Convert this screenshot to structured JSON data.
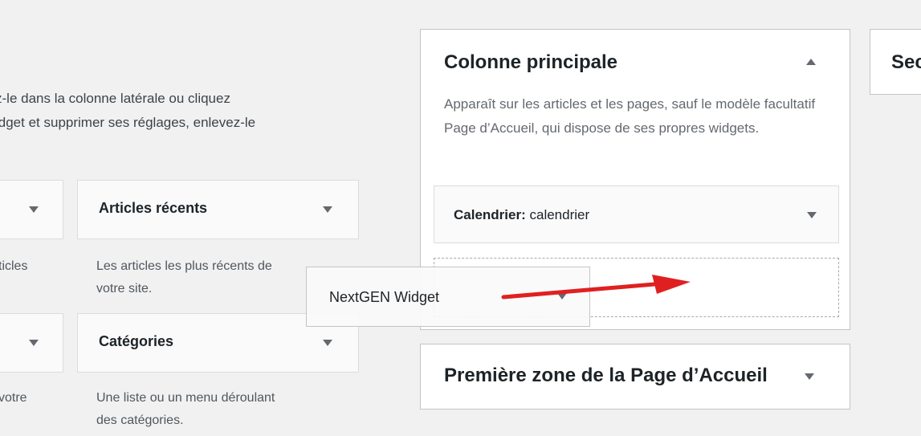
{
  "intro": {
    "line1": "z-le dans la colonne latérale ou cliquez",
    "line2": "idget et supprimer ses réglages, enlevez-le"
  },
  "available_widgets": [
    {
      "title": "",
      "desc": "ticles"
    },
    {
      "title": "Articles récents",
      "desc_line1": "Les articles les plus récents de",
      "desc_line2": "votre site."
    },
    {
      "title": "",
      "desc": "votre"
    },
    {
      "title": "Catégories",
      "desc_line1": "Une liste ou un menu déroulant",
      "desc_line2": "des catégories."
    }
  ],
  "sidebar_main": {
    "title": "Colonne principale",
    "desc": "Apparaît sur les articles et les pages, sauf le modèle facultatif Page d’Accueil, qui dispose de ses propres widgets.",
    "widget_label": "Calendrier:",
    "widget_name": "calendrier"
  },
  "dragging_widget": {
    "title": "NextGEN Widget"
  },
  "sidebar_zone2": {
    "title": "Première zone de la Page d’Accueil"
  },
  "sidebar_right": {
    "title": "Seconde"
  },
  "colors": {
    "annotation_arrow": "#e02020"
  }
}
